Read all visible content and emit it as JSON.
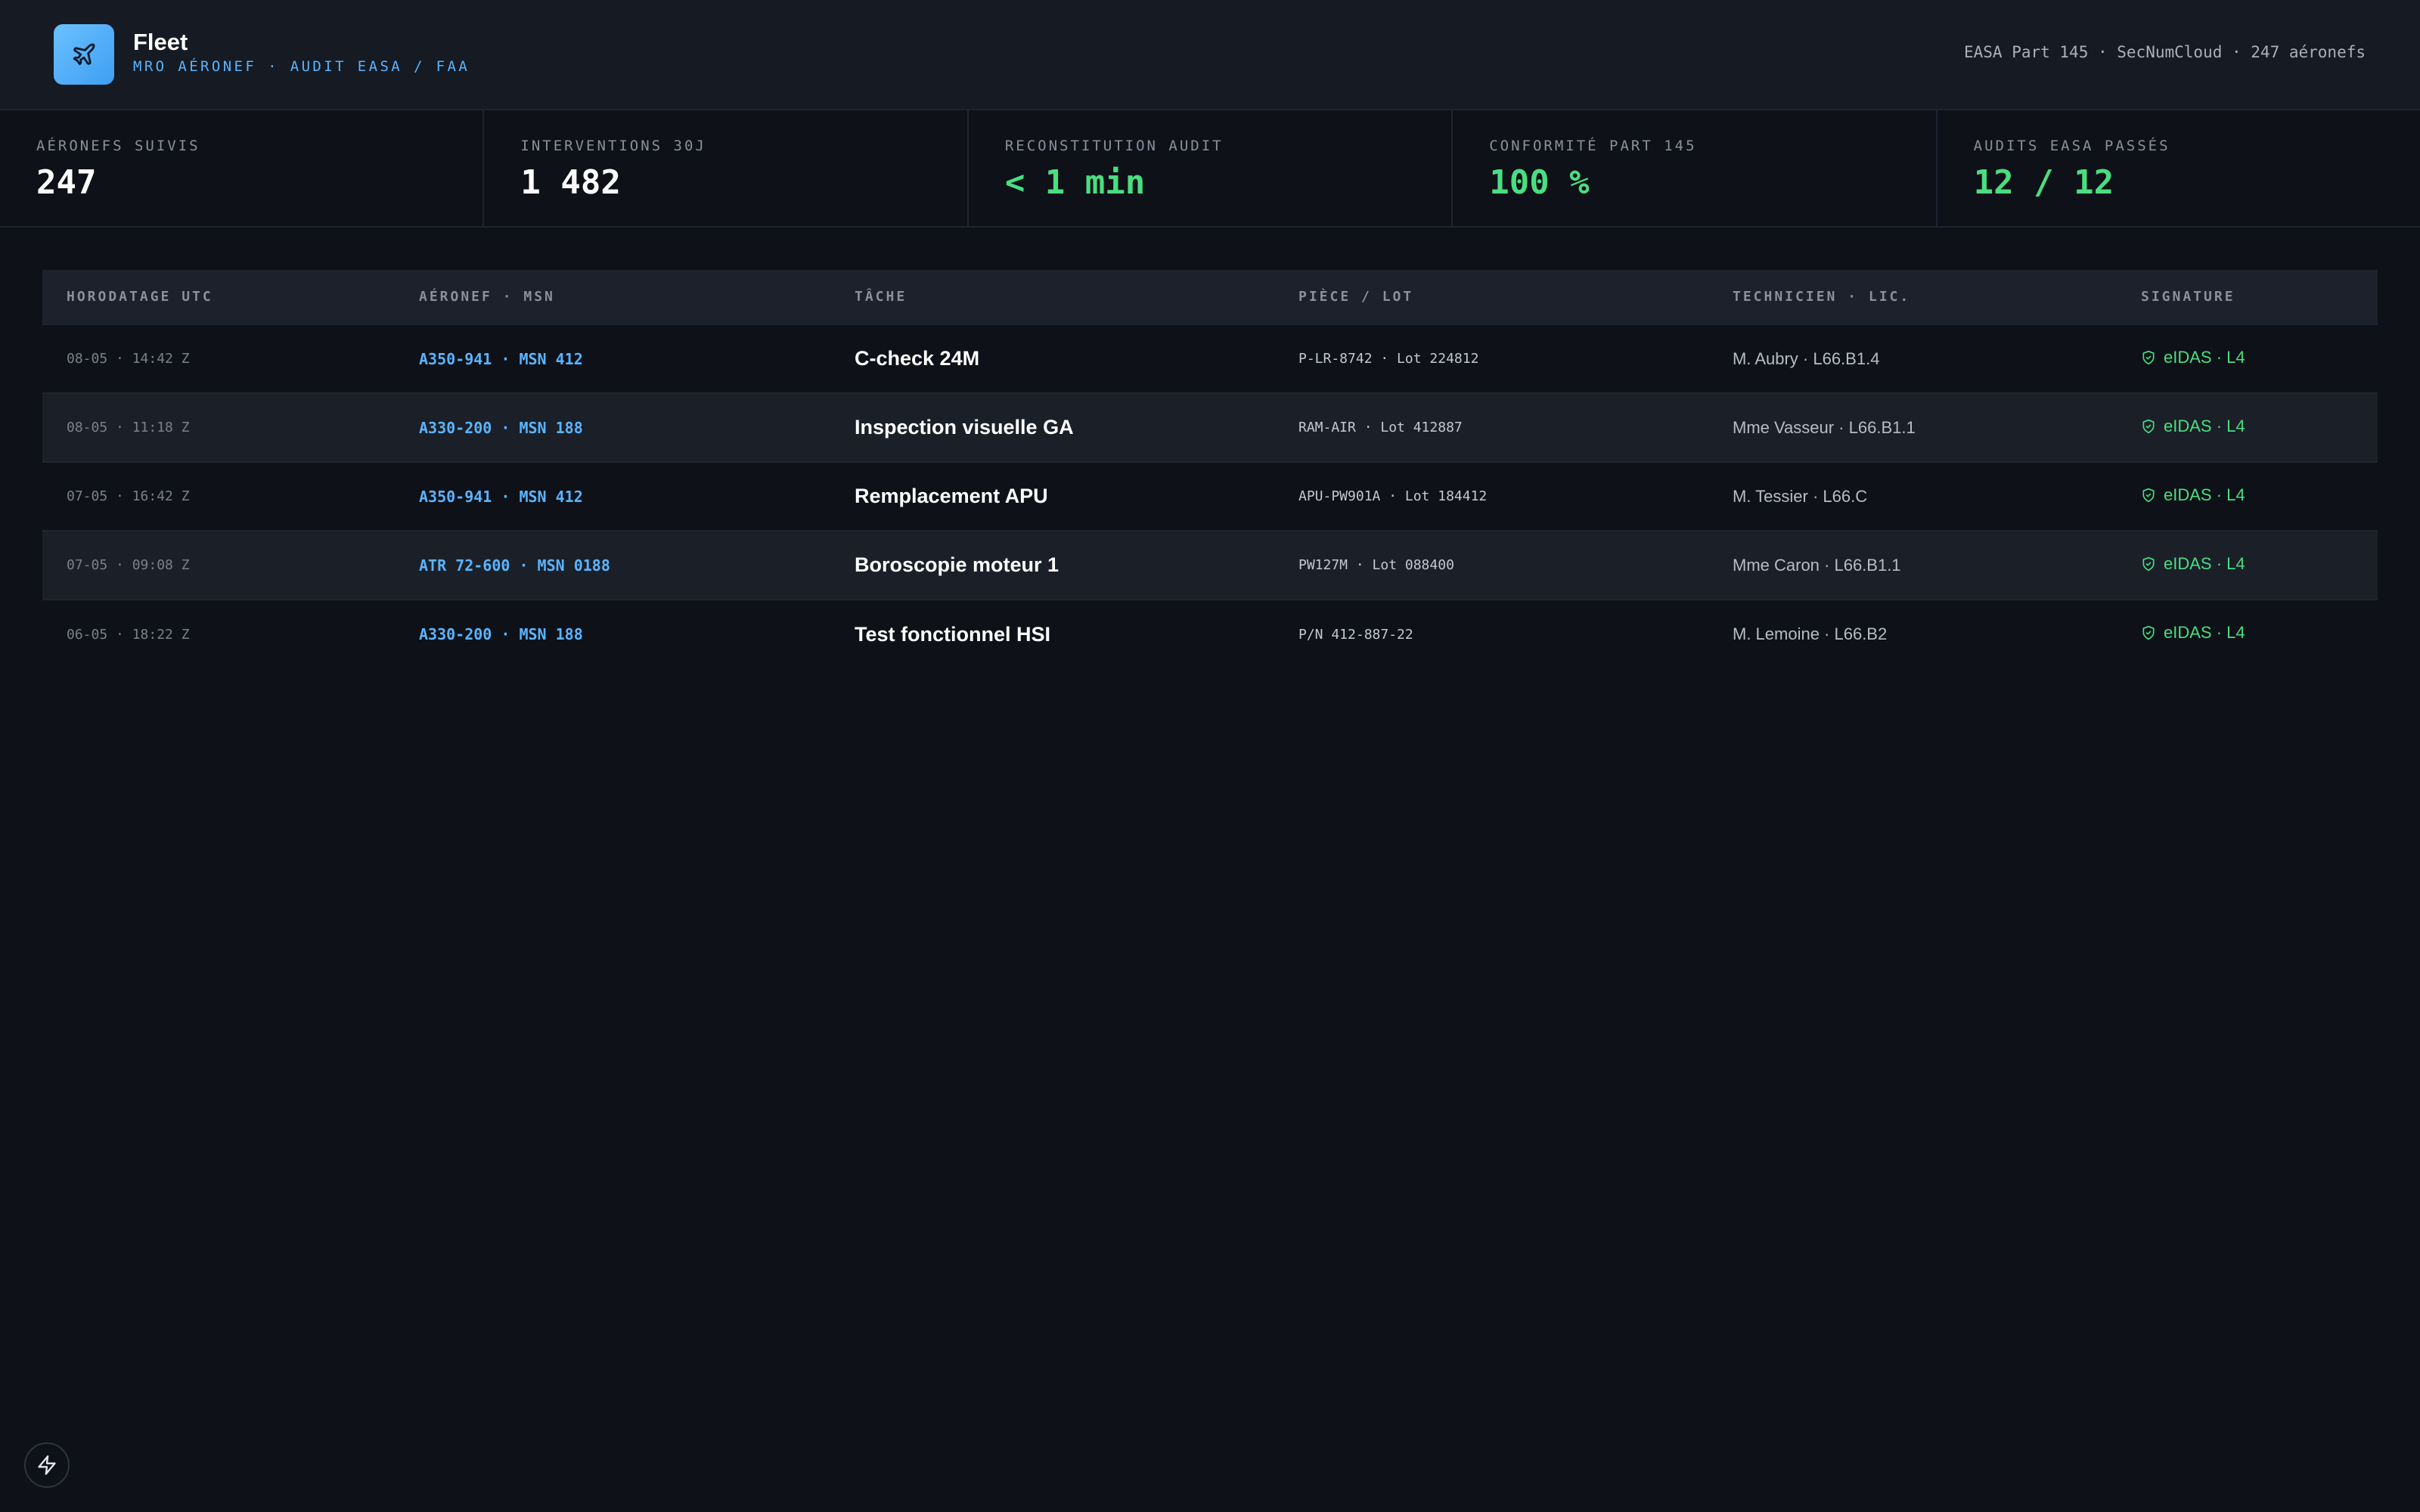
{
  "app": {
    "title": "Fleet",
    "subtitle": "MRO AÉRONEF · AUDIT EASA / FAA",
    "meta": "EASA Part 145 · SecNumCloud · 247 aéronefs",
    "logo_icon": "airplane-icon",
    "accent_color": "#5ab4ff"
  },
  "stats": [
    {
      "label": "AÉRONEFS SUIVIS",
      "value": "247"
    },
    {
      "label": "INTERVENTIONS 30J",
      "value": "1 482"
    },
    {
      "label": "RECONSTITUTION AUDIT",
      "value": "< 1 min",
      "color": "#4ade80"
    },
    {
      "label": "CONFORMITÉ PART 145",
      "value": "100 %",
      "color": "#4ade80"
    },
    {
      "label": "AUDITS EASA PASSÉS",
      "value": "12 / 12",
      "color": "#4ade80"
    }
  ],
  "table": {
    "headers": [
      "HORODATAGE UTC",
      "AÉRONEF · MSN",
      "TÂCHE",
      "PIÈCE / LOT",
      "TECHNICIEN · LIC.",
      "SIGNATURE"
    ],
    "rows": [
      {
        "time": "08-05 · 14:42 Z",
        "aircraft": "A350-941 · MSN 412",
        "task": "C-check 24M",
        "part": "P-LR-8742 · Lot 224812",
        "tech": "M. Aubry · L66.B1.4",
        "signature": "eIDAS · L4"
      },
      {
        "time": "08-05 · 11:18 Z",
        "aircraft": "A330-200 · MSN 188",
        "task": "Inspection visuelle GA",
        "part": "RAM-AIR · Lot 412887",
        "tech": "Mme Vasseur · L66.B1.1",
        "signature": "eIDAS · L4"
      },
      {
        "time": "07-05 · 16:42 Z",
        "aircraft": "A350-941 · MSN 412",
        "task": "Remplacement APU",
        "part": "APU-PW901A · Lot 184412",
        "tech": "M. Tessier · L66.C",
        "signature": "eIDAS · L4"
      },
      {
        "time": "07-05 · 09:08 Z",
        "aircraft": "ATR 72-600 · MSN 0188",
        "task": "Boroscopie moteur 1",
        "part": "PW127M · Lot 088400",
        "tech": "Mme Caron · L66.B1.1",
        "signature": "eIDAS · L4"
      },
      {
        "time": "06-05 · 18:22 Z",
        "aircraft": "A330-200 · MSN 188",
        "task": "Test fonctionnel HSI",
        "part": "P/N 412-887-22",
        "tech": "M. Lemoine · L66.B2",
        "signature": "eIDAS · L4"
      }
    ],
    "signature_icon": "shield-check-icon",
    "signature_color": "#4ade80"
  },
  "fab": {
    "icon": "lightning-icon"
  }
}
